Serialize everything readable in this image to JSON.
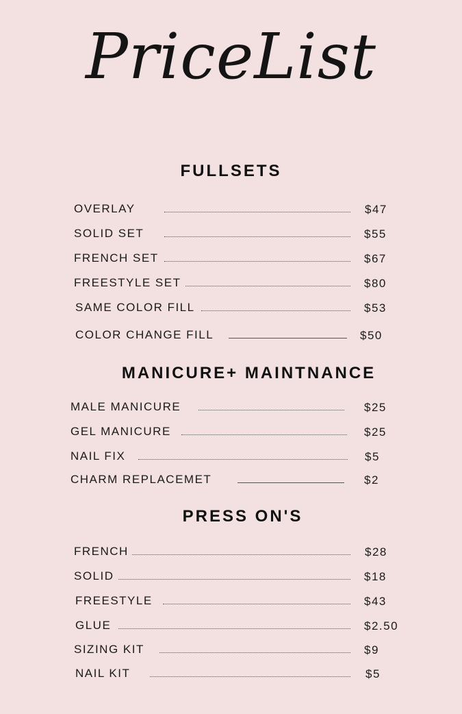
{
  "title": "PriceList",
  "sections": [
    {
      "heading": "FULLSETS",
      "items": [
        {
          "name": "OVERLAY",
          "price": "$47"
        },
        {
          "name": "SOLID SET",
          "price": "$55"
        },
        {
          "name": "FRENCH SET",
          "price": "$67"
        },
        {
          "name": "FREESTYLE SET",
          "price": "$80"
        },
        {
          "name": "SAME COLOR FILL",
          "price": "$53"
        },
        {
          "name": "COLOR CHANGE FILL",
          "price": "$50"
        }
      ]
    },
    {
      "heading": "MANICURE+ MAINTNANCE",
      "items": [
        {
          "name": "MALE MANICURE",
          "price": "$25"
        },
        {
          "name": "GEL MANICURE",
          "price": "$25"
        },
        {
          "name": "NAIL FIX",
          "price": "$5"
        },
        {
          "name": "CHARM REPLACEMET",
          "price": "$2"
        }
      ]
    },
    {
      "heading": "PRESS ON'S",
      "items": [
        {
          "name": "FRENCH",
          "price": "$28"
        },
        {
          "name": "SOLID",
          "price": "$18"
        },
        {
          "name": "FREESTYLE",
          "price": "$43"
        },
        {
          "name": "GLUE",
          "price": "$2.50"
        },
        {
          "name": "SIZING KIT",
          "price": "$9"
        },
        {
          "name": "NAIL KIT",
          "price": "$5"
        }
      ]
    }
  ]
}
